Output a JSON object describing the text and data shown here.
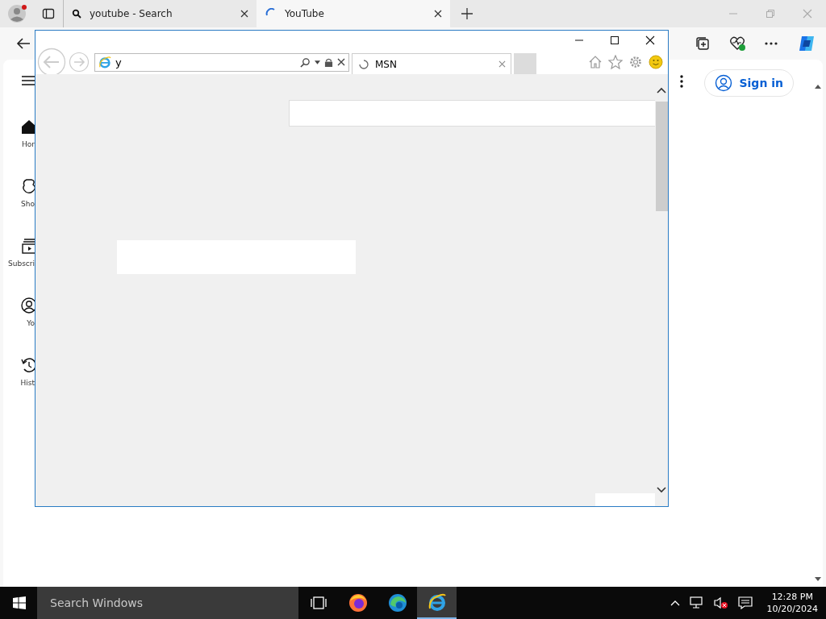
{
  "edge": {
    "tabs": [
      {
        "title": "youtube - Search",
        "selected": false,
        "kind": "search"
      },
      {
        "title": "YouTube",
        "selected": true,
        "kind": "loading"
      }
    ],
    "youtube": {
      "sidebar": [
        {
          "label": "Hor",
          "kind": "home"
        },
        {
          "label": "Sho",
          "kind": "shorts"
        },
        {
          "label": "Subscri",
          "kind": "subscriptions"
        },
        {
          "label": "Yo",
          "kind": "you"
        },
        {
          "label": "Hist",
          "kind": "history"
        }
      ],
      "sign_in": "Sign in"
    }
  },
  "ie_window": {
    "address": {
      "value": "y"
    },
    "tabs": [
      {
        "title": "MSN",
        "selected": true
      }
    ]
  },
  "taskbar": {
    "search": {
      "placeholder": "Search Windows"
    },
    "apps": [
      {
        "kind": "task-view",
        "selected": false
      },
      {
        "kind": "firefox",
        "selected": false
      },
      {
        "kind": "edge",
        "selected": false
      },
      {
        "kind": "ie",
        "selected": true
      }
    ],
    "time": "12:28 PM",
    "date": "10/20/2024"
  }
}
